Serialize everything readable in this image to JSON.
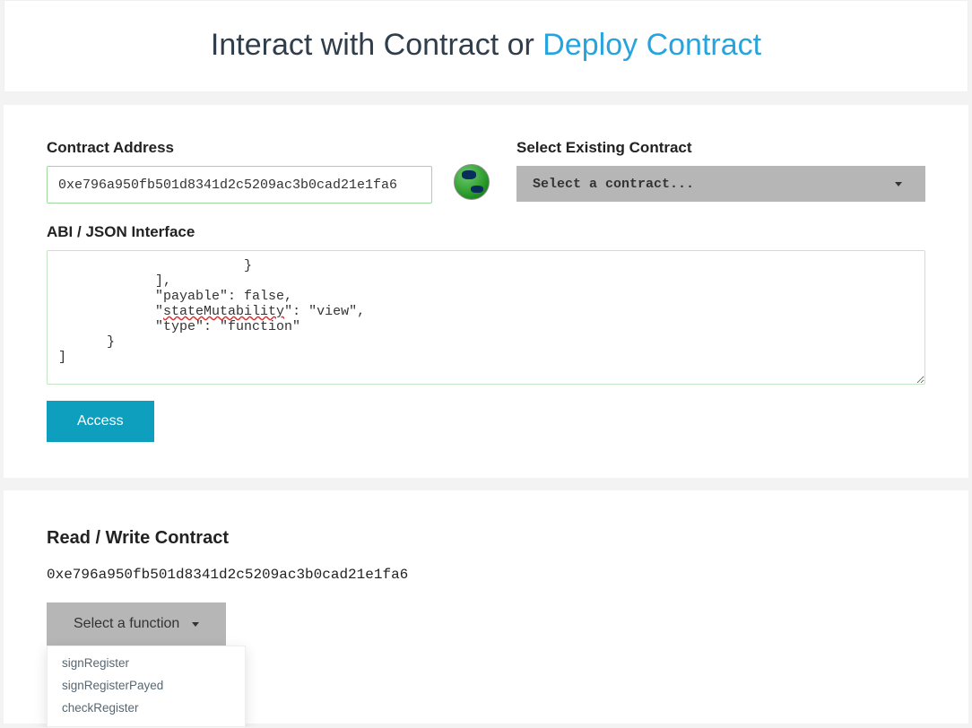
{
  "header": {
    "title_main": "Interact with Contract",
    "title_or": "or",
    "title_link": "Deploy Contract"
  },
  "panel": {
    "contract_address_label": "Contract Address",
    "contract_address_value": "0xe796a950fb501d8341d2c5209ac3b0cad21e1fa6",
    "select_existing_label": "Select Existing Contract",
    "select_existing_value": "Select a contract...",
    "abi_label": "ABI / JSON Interface",
    "abi_text_pre": "                       }\n            ],\n            \"payable\": false,\n            \"",
    "abi_text_squiggle": "stateMutability",
    "abi_text_post": "\": \"view\",\n            \"type\": \"function\"\n      }\n]",
    "access_label": "Access"
  },
  "readwrite": {
    "title": "Read / Write Contract",
    "address": "0xe796a950fb501d8341d2c5209ac3b0cad21e1fa6",
    "select_fn_label": "Select a function",
    "functions": [
      "signRegister",
      "signRegisterPayed",
      "checkRegister"
    ]
  }
}
